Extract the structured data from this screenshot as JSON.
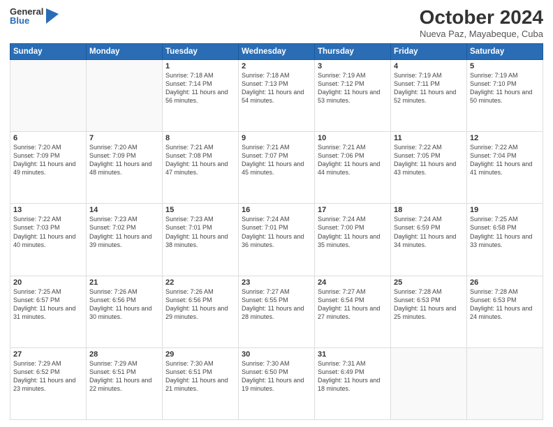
{
  "logo": {
    "general": "General",
    "blue": "Blue"
  },
  "header": {
    "month": "October 2024",
    "location": "Nueva Paz, Mayabeque, Cuba"
  },
  "days_of_week": [
    "Sunday",
    "Monday",
    "Tuesday",
    "Wednesday",
    "Thursday",
    "Friday",
    "Saturday"
  ],
  "weeks": [
    [
      {
        "day": null
      },
      {
        "day": null
      },
      {
        "day": "1",
        "sunrise": "7:18 AM",
        "sunset": "7:14 PM",
        "daylight": "11 hours and 56 minutes."
      },
      {
        "day": "2",
        "sunrise": "7:18 AM",
        "sunset": "7:13 PM",
        "daylight": "11 hours and 54 minutes."
      },
      {
        "day": "3",
        "sunrise": "7:19 AM",
        "sunset": "7:12 PM",
        "daylight": "11 hours and 53 minutes."
      },
      {
        "day": "4",
        "sunrise": "7:19 AM",
        "sunset": "7:11 PM",
        "daylight": "11 hours and 52 minutes."
      },
      {
        "day": "5",
        "sunrise": "7:19 AM",
        "sunset": "7:10 PM",
        "daylight": "11 hours and 50 minutes."
      }
    ],
    [
      {
        "day": "6",
        "sunrise": "7:20 AM",
        "sunset": "7:09 PM",
        "daylight": "11 hours and 49 minutes."
      },
      {
        "day": "7",
        "sunrise": "7:20 AM",
        "sunset": "7:09 PM",
        "daylight": "11 hours and 48 minutes."
      },
      {
        "day": "8",
        "sunrise": "7:21 AM",
        "sunset": "7:08 PM",
        "daylight": "11 hours and 47 minutes."
      },
      {
        "day": "9",
        "sunrise": "7:21 AM",
        "sunset": "7:07 PM",
        "daylight": "11 hours and 45 minutes."
      },
      {
        "day": "10",
        "sunrise": "7:21 AM",
        "sunset": "7:06 PM",
        "daylight": "11 hours and 44 minutes."
      },
      {
        "day": "11",
        "sunrise": "7:22 AM",
        "sunset": "7:05 PM",
        "daylight": "11 hours and 43 minutes."
      },
      {
        "day": "12",
        "sunrise": "7:22 AM",
        "sunset": "7:04 PM",
        "daylight": "11 hours and 41 minutes."
      }
    ],
    [
      {
        "day": "13",
        "sunrise": "7:22 AM",
        "sunset": "7:03 PM",
        "daylight": "11 hours and 40 minutes."
      },
      {
        "day": "14",
        "sunrise": "7:23 AM",
        "sunset": "7:02 PM",
        "daylight": "11 hours and 39 minutes."
      },
      {
        "day": "15",
        "sunrise": "7:23 AM",
        "sunset": "7:01 PM",
        "daylight": "11 hours and 38 minutes."
      },
      {
        "day": "16",
        "sunrise": "7:24 AM",
        "sunset": "7:01 PM",
        "daylight": "11 hours and 36 minutes."
      },
      {
        "day": "17",
        "sunrise": "7:24 AM",
        "sunset": "7:00 PM",
        "daylight": "11 hours and 35 minutes."
      },
      {
        "day": "18",
        "sunrise": "7:24 AM",
        "sunset": "6:59 PM",
        "daylight": "11 hours and 34 minutes."
      },
      {
        "day": "19",
        "sunrise": "7:25 AM",
        "sunset": "6:58 PM",
        "daylight": "11 hours and 33 minutes."
      }
    ],
    [
      {
        "day": "20",
        "sunrise": "7:25 AM",
        "sunset": "6:57 PM",
        "daylight": "11 hours and 31 minutes."
      },
      {
        "day": "21",
        "sunrise": "7:26 AM",
        "sunset": "6:56 PM",
        "daylight": "11 hours and 30 minutes."
      },
      {
        "day": "22",
        "sunrise": "7:26 AM",
        "sunset": "6:56 PM",
        "daylight": "11 hours and 29 minutes."
      },
      {
        "day": "23",
        "sunrise": "7:27 AM",
        "sunset": "6:55 PM",
        "daylight": "11 hours and 28 minutes."
      },
      {
        "day": "24",
        "sunrise": "7:27 AM",
        "sunset": "6:54 PM",
        "daylight": "11 hours and 27 minutes."
      },
      {
        "day": "25",
        "sunrise": "7:28 AM",
        "sunset": "6:53 PM",
        "daylight": "11 hours and 25 minutes."
      },
      {
        "day": "26",
        "sunrise": "7:28 AM",
        "sunset": "6:53 PM",
        "daylight": "11 hours and 24 minutes."
      }
    ],
    [
      {
        "day": "27",
        "sunrise": "7:29 AM",
        "sunset": "6:52 PM",
        "daylight": "11 hours and 23 minutes."
      },
      {
        "day": "28",
        "sunrise": "7:29 AM",
        "sunset": "6:51 PM",
        "daylight": "11 hours and 22 minutes."
      },
      {
        "day": "29",
        "sunrise": "7:30 AM",
        "sunset": "6:51 PM",
        "daylight": "11 hours and 21 minutes."
      },
      {
        "day": "30",
        "sunrise": "7:30 AM",
        "sunset": "6:50 PM",
        "daylight": "11 hours and 19 minutes."
      },
      {
        "day": "31",
        "sunrise": "7:31 AM",
        "sunset": "6:49 PM",
        "daylight": "11 hours and 18 minutes."
      },
      {
        "day": null
      },
      {
        "day": null
      }
    ]
  ]
}
